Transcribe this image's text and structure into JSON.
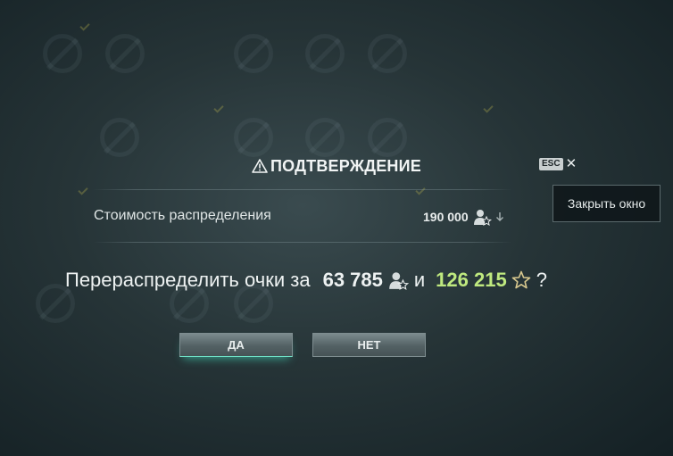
{
  "dialog": {
    "title": "ПОДТВЕРЖДЕНИЕ",
    "esc_label": "ESC",
    "close_tooltip": "Закрыть окно",
    "cost_label": "Стоимость распределения",
    "cost_value": "190 000",
    "question_prefix": "Перераспределить очки за",
    "value_commander_xp": "63 785",
    "conjunction": "и",
    "value_elite_xp": "126 215",
    "question_suffix": "?",
    "yes_label": "ДА",
    "no_label": "НЕТ"
  },
  "icons": {
    "warning": "warning-triangle-icon",
    "close": "close-icon",
    "commander_xp": "commander-xp-icon",
    "elite_xp": "elite-xp-star-icon",
    "arrow": "arrow-down-icon"
  },
  "colors": {
    "elite_value": "#bfe97f",
    "button_accent": "#6fe0c6"
  }
}
